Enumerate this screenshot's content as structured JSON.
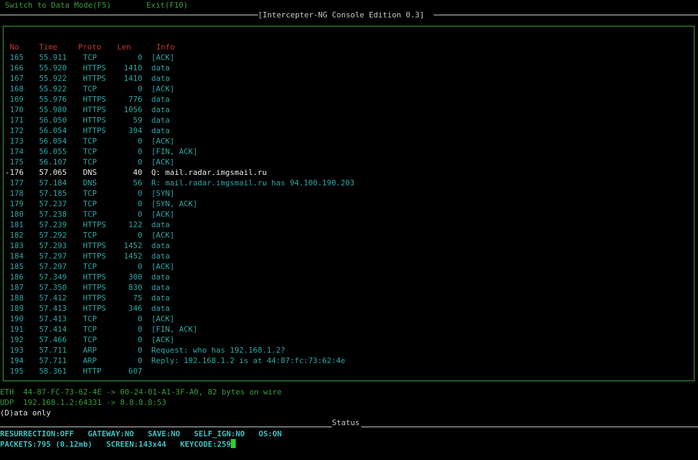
{
  "menu": {
    "switch_label": "Switch to Data Mode(F5)",
    "exit_label": "Exit(F10)"
  },
  "title": "[Intercepter-NG Console Edition 0.3]",
  "columns": {
    "no": "No",
    "time": "Time",
    "proto": "Proto",
    "len": "Len",
    "info": "Info"
  },
  "selected_row": 11,
  "packets": [
    {
      "no": "165",
      "time": "55.911",
      "proto": "TCP",
      "len": "0",
      "info": "[ACK]"
    },
    {
      "no": "166",
      "time": "55.920",
      "proto": "HTTPS",
      "len": "1410",
      "info": "data"
    },
    {
      "no": "167",
      "time": "55.922",
      "proto": "HTTPS",
      "len": "1410",
      "info": "data"
    },
    {
      "no": "168",
      "time": "55.922",
      "proto": "TCP",
      "len": "0",
      "info": "[ACK]"
    },
    {
      "no": "169",
      "time": "55.976",
      "proto": "HTTPS",
      "len": "776",
      "info": "data"
    },
    {
      "no": "170",
      "time": "55.980",
      "proto": "HTTPS",
      "len": "1056",
      "info": "data"
    },
    {
      "no": "171",
      "time": "56.050",
      "proto": "HTTPS",
      "len": "59",
      "info": "data"
    },
    {
      "no": "172",
      "time": "56.054",
      "proto": "HTTPS",
      "len": "394",
      "info": "data"
    },
    {
      "no": "173",
      "time": "56.054",
      "proto": "TCP",
      "len": "0",
      "info": "[ACK]"
    },
    {
      "no": "174",
      "time": "56.055",
      "proto": "TCP",
      "len": "0",
      "info": "[FIN, ACK]"
    },
    {
      "no": "175",
      "time": "56.107",
      "proto": "TCP",
      "len": "0",
      "info": "[ACK]"
    },
    {
      "no": "176",
      "time": "57.065",
      "proto": "DNS",
      "len": "40",
      "info": "Q: mail.radar.imgsmail.ru"
    },
    {
      "no": "177",
      "time": "57.184",
      "proto": "DNS",
      "len": "56",
      "info": "R: mail.radar.imgsmail.ru has 94.100.190.203"
    },
    {
      "no": "178",
      "time": "57.185",
      "proto": "TCP",
      "len": "0",
      "info": "[SYN]"
    },
    {
      "no": "179",
      "time": "57.237",
      "proto": "TCP",
      "len": "0",
      "info": "[SYN, ACK]"
    },
    {
      "no": "180",
      "time": "57.238",
      "proto": "TCP",
      "len": "0",
      "info": "[ACK]"
    },
    {
      "no": "181",
      "time": "57.239",
      "proto": "HTTPS",
      "len": "122",
      "info": "data"
    },
    {
      "no": "182",
      "time": "57.292",
      "proto": "TCP",
      "len": "0",
      "info": "[ACK]"
    },
    {
      "no": "183",
      "time": "57.293",
      "proto": "HTTPS",
      "len": "1452",
      "info": "data"
    },
    {
      "no": "184",
      "time": "57.297",
      "proto": "HTTPS",
      "len": "1452",
      "info": "data"
    },
    {
      "no": "185",
      "time": "57.297",
      "proto": "TCP",
      "len": "0",
      "info": "[ACK]"
    },
    {
      "no": "186",
      "time": "57.349",
      "proto": "HTTPS",
      "len": "300",
      "info": "data"
    },
    {
      "no": "187",
      "time": "57.350",
      "proto": "HTTPS",
      "len": "830",
      "info": "data"
    },
    {
      "no": "188",
      "time": "57.412",
      "proto": "HTTPS",
      "len": "75",
      "info": "data"
    },
    {
      "no": "189",
      "time": "57.413",
      "proto": "HTTPS",
      "len": "346",
      "info": "data"
    },
    {
      "no": "190",
      "time": "57.413",
      "proto": "TCP",
      "len": "0",
      "info": "[ACK]"
    },
    {
      "no": "191",
      "time": "57.414",
      "proto": "TCP",
      "len": "0",
      "info": "[FIN, ACK]"
    },
    {
      "no": "192",
      "time": "57.466",
      "proto": "TCP",
      "len": "0",
      "info": "[ACK]"
    },
    {
      "no": "193",
      "time": "57.711",
      "proto": "ARP",
      "len": "0",
      "info": "Request: who has 192.168.1.2?"
    },
    {
      "no": "194",
      "time": "57.711",
      "proto": "ARP",
      "len": "0",
      "info": "Reply: 192.168.1.2 is at 44:87:fc:73:62:4e"
    },
    {
      "no": "195",
      "time": "58.361",
      "proto": "HTTP",
      "len": "607",
      "info": ""
    }
  ],
  "details": {
    "eth": "ETH  44-87-FC-73-62-4E -> 00-24-01-A1-3F-A0, 82 bytes on wire",
    "udp": "UDP  192.168.1.2:64331 -> 8.8.8.8:53",
    "data_only": "(D)ata only"
  },
  "status": {
    "label": "Status",
    "line1": "RESURRECTION:OFF   GATEWAY:NO   SAVE:NO   SELF_IGN:NO   OS:ON",
    "line2": "PACKETS:795 (0.12mb)   SCREEN:143x44   KEYCODE:259"
  },
  "colors": {
    "cyan": "#2fa7a7",
    "green": "#3a9e3a",
    "header_red": "#c0392b",
    "cursor": "#2bd12b"
  }
}
